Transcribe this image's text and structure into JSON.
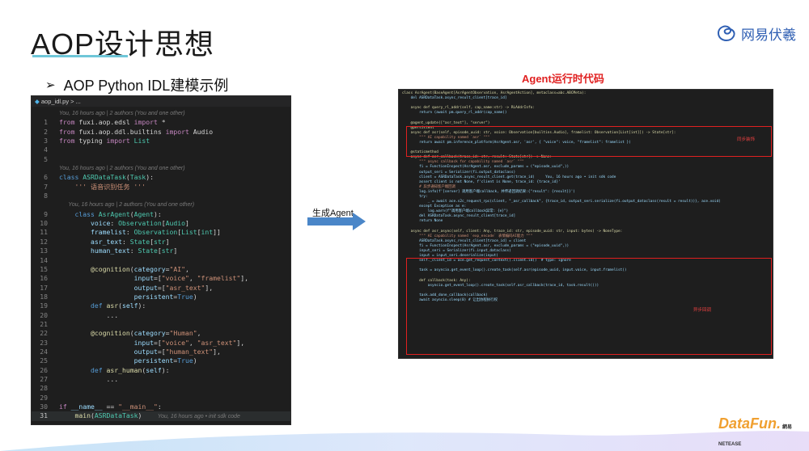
{
  "slide": {
    "title": "AOP设计思想",
    "subtitle_bullet": "➢",
    "subtitle": "AOP Python IDL建模示例",
    "logo_text": "网易伏羲",
    "arrow_label": "生成Agent",
    "right_title": "Agent运行时代码",
    "bottom_logo": "DataFun.",
    "bottom_logo_small": "網易 NETEASE"
  },
  "editor": {
    "filename": "aop_idl.py",
    "tab_suffix": " > ...",
    "lines": [
      {
        "n": "",
        "blame": "You, 16 hours ago | 2 authors (You and one other)"
      },
      {
        "n": "1",
        "html": "<span class='kw'>from</span> <span class='txt'>fuxi.aop.edsl</span> <span class='kw'>import</span> *"
      },
      {
        "n": "2",
        "html": "<span class='kw'>from</span> <span class='txt'>fuxi.aop.ddl.builtins</span> <span class='kw'>import</span> Audio"
      },
      {
        "n": "3",
        "html": "<span class='kw'>from</span> typing <span class='kw'>import</span> <span class='cls'>List</span>"
      },
      {
        "n": "4",
        "html": ""
      },
      {
        "n": "5",
        "html": ""
      },
      {
        "n": "",
        "blame": "You, 16 hours ago | 2 authors (You and one other)"
      },
      {
        "n": "6",
        "html": "<span class='kw2'>class</span> <span class='cls'>ASRDataTask</span>(<span class='cls'>Task</span>):"
      },
      {
        "n": "7",
        "html": "    <span class='str'>''' 语音识别任务 '''</span>"
      },
      {
        "n": "8",
        "html": ""
      },
      {
        "n": "",
        "blame": "      You, 16 hours ago | 2 authors (You and one other)"
      },
      {
        "n": "9",
        "html": "    <span class='kw2'>class</span> <span class='cls'>AsrAgent</span>(<span class='cls'>Agent</span>):"
      },
      {
        "n": "10",
        "html": "        <span class='var'>voice</span>: <span class='cls'>Observation</span>[<span class='cls'>Audio</span>]"
      },
      {
        "n": "11",
        "html": "        <span class='var'>framelist</span>: <span class='cls'>Observation</span>[<span class='cls'>List</span>[<span class='cls'>int</span>]]"
      },
      {
        "n": "12",
        "html": "        <span class='var'>asr_text</span>: <span class='cls'>State</span>[<span class='cls'>str</span>]"
      },
      {
        "n": "13",
        "html": "        <span class='var'>human_text</span>: <span class='cls'>State</span>[<span class='cls'>str</span>]"
      },
      {
        "n": "14",
        "html": ""
      },
      {
        "n": "15",
        "html": "        <span class='dec'>@cognition</span>(<span class='var'>category</span>=<span class='str'>\"AI\"</span>,"
      },
      {
        "n": "16",
        "html": "                   <span class='var'>input</span>=[<span class='str'>\"voice\"</span>, <span class='str'>\"framelist\"</span>],"
      },
      {
        "n": "17",
        "html": "                   <span class='var'>output</span>=[<span class='str'>\"asr_text\"</span>],"
      },
      {
        "n": "18",
        "html": "                   <span class='var'>persistent</span>=<span class='kw2'>True</span>)"
      },
      {
        "n": "19",
        "html": "        <span class='kw2'>def</span> <span class='fn'>asr</span>(<span class='var'>self</span>):"
      },
      {
        "n": "20",
        "html": "            ..."
      },
      {
        "n": "21",
        "html": ""
      },
      {
        "n": "22",
        "html": "        <span class='dec'>@cognition</span>(<span class='var'>category</span>=<span class='str'>\"Human\"</span>,"
      },
      {
        "n": "23",
        "html": "                   <span class='var'>input</span>=[<span class='str'>\"voice\"</span>, <span class='str'>\"asr_text\"</span>],"
      },
      {
        "n": "24",
        "html": "                   <span class='var'>output</span>=[<span class='str'>\"human_text\"</span>],"
      },
      {
        "n": "25",
        "html": "                   <span class='var'>persistent</span>=<span class='kw2'>True</span>)"
      },
      {
        "n": "26",
        "html": "        <span class='kw2'>def</span> <span class='fn'>asr_human</span>(<span class='var'>self</span>):"
      },
      {
        "n": "27",
        "html": "            ..."
      },
      {
        "n": "28",
        "html": ""
      },
      {
        "n": "29",
        "html": ""
      },
      {
        "n": "30",
        "html": "<span class='kw'>if</span> <span class='var'>__name__</span> == <span class='str'>\"__main__\"</span>:"
      },
      {
        "n": "31",
        "html": "    <span class='fn'>main</span>(<span class='cls'>ASRDataTask</span>)    <span class='blame'>You, 16 hours ago • init sdk code</span>",
        "cur": true
      }
    ]
  },
  "runtime": {
    "lines": [
      "class AsrAgent(BaseAgent[AsrAgentObservation, AsrAgentAction], metaclass=abc.ABCMeta):",
      "    del ASRDataTask.async_result_client[trace_id]",
      "",
      "    async def query_rl_addr(self, cap_name:str) -> RLAddrInfo:",
      "        return (await pm.query_rl_addr(cap_name))",
      "",
      "    @agent_update([\"asr_text\"], \"server\")",
      "    @persistent",
      "    async def asr(self, episode_uuid: str, voice: Observation[builtins.Audio], framelist: Observation[List[int]]) -> State[str]:",
      "        \"\"\" AI capability named `asr` \"\"\"",
      "        return await pm.inference_platform(AsrAgent.asr, 'asr', { \"voice\": voice, \"framelist\": framelist })",
      "",
      "    @staticmethod",
      "    async def asr_callback(trace_id: str, result: State[str]) -> None:",
      "        \"\"\" async callback for capability named `asr` \"\"\"",
      "        fi = FunctionInspect(AsrAgent.asr, exclude_params = (\"episode_uuid\",))",
      "        output_seri = Serializer(fi.output_dataclass)",
      "        client = ASRDataTask.async_result_client.get(trace_id)     You, 16 hours ago • init sdk code",
      "        assert client is not None, f'client is None, trace_id: {trace_id}'",
      "        # 异步通知客户端回调",
      "        log.info(f'[server] 调用客户端callback, 并传递回调结果:{\"result\": {result}}')",
      "        try:",
      "            _ = await ace.s2c_request_rpc(client, \"_asr_callback\", {trace_id, output_seri.serialize(fi.output_dataclass(result = result))}, ace.void)",
      "        except Exception as e:",
      "            log.warn(f\"调用客户端callback异常: {e}\")",
      "        del ASRDataTask.async_result_client[trace_id]",
      "        return None",
      "",
      "    async def asr_async(self, client: Any, trace_id: str, episode_uuid: str, input: bytes) -> NoneType:",
      "        \"\"\" AI capability named `exp_encode` 表情编码AI能力 \"\"\"",
      "        ASRDataTask.async_result_client[trace_id] = client",
      "        fi = FunctionInspect(AsrAgent.asr, exclude_params = (\"episode_uuid\",))",
      "        input_seri = Serializer(fi.input_dataclass)",
      "        input = input_seri.deserialize(input)",
      "        self._client_id = ace.get_request_context().client.id()  # type: ignore",
      "",
      "        task = asyncio.get_event_loop().create_task(self.asr(episode_uuid, input.voice, input.framelist))",
      "",
      "        def callback(task: Any):",
      "            asyncio.get_event_loop().create_task(self.asr_callback(trace_id, task.result()))",
      "",
      "        task.add_done_callback(callback)",
      "        await asyncio.sleep(0) # 让出协程执行权"
    ],
    "note_sync": "同步装饰",
    "note_async": "异步回调"
  },
  "colors": {
    "accent_underline": "#6fc6d8",
    "red": "#e02020",
    "arrow": "#4a86c8"
  }
}
